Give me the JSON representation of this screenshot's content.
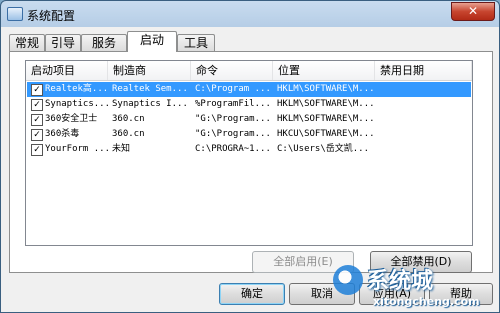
{
  "window": {
    "title": "系统配置",
    "close_label": "✕"
  },
  "tabs": [
    {
      "label": "常规"
    },
    {
      "label": "引导"
    },
    {
      "label": "服务"
    },
    {
      "label": "启动",
      "active": true
    },
    {
      "label": "工具"
    }
  ],
  "table": {
    "headers": [
      "启动项目",
      "制造商",
      "命令",
      "位置",
      "禁用日期"
    ],
    "rows": [
      {
        "checked": true,
        "name": "Realtek高...",
        "maker": "Realtek Sem...",
        "command": "C:\\Program ...",
        "location": "HKLM\\SOFTWARE\\M...",
        "disabled": "",
        "selected": true
      },
      {
        "checked": true,
        "name": "Synaptics...",
        "maker": "Synaptics I...",
        "command": "%ProgramFil...",
        "location": "HKLM\\SOFTWARE\\M...",
        "disabled": ""
      },
      {
        "checked": true,
        "name": "360安全卫士",
        "maker": "360.cn",
        "command": "\"G:\\Program...",
        "location": "HKLM\\SOFTWARE\\M...",
        "disabled": ""
      },
      {
        "checked": true,
        "name": "360杀毒",
        "maker": "360.cn",
        "command": "\"G:\\Program...",
        "location": "HKCU\\SOFTWARE\\M...",
        "disabled": ""
      },
      {
        "checked": true,
        "name": "YourForm ...",
        "maker": "未知",
        "command": "C:\\PROGRA~1...",
        "location": "C:\\Users\\岳文凯...",
        "disabled": ""
      }
    ]
  },
  "buttons": {
    "enable_all": "全部启用(E)",
    "disable_all": "全部禁用(D)",
    "ok": "确定",
    "cancel": "取消",
    "apply": "应用(A)",
    "help": "帮助"
  },
  "watermark": {
    "brand": "系统城",
    "url": "xitongcheng.com"
  }
}
